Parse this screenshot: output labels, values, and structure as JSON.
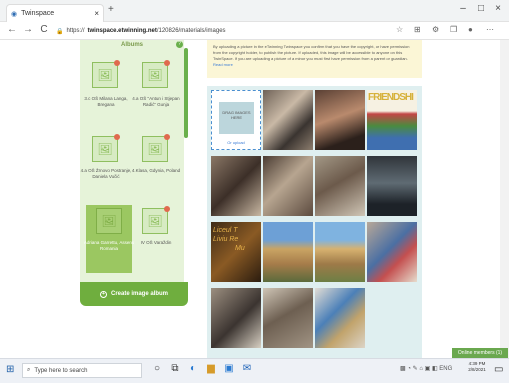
{
  "browser": {
    "tab_title": "Twinspace",
    "tab_close": "×",
    "new_tab": "+",
    "minimize": "–",
    "maximize": "□",
    "close": "×",
    "url_prefix": "https://",
    "url_host": "twinspace.etwinning.net",
    "url_path": "/120826/materials/images",
    "back": "←",
    "forward": "→",
    "reload": "C"
  },
  "albums": {
    "title": "Albums",
    "items": [
      {
        "caption": "3.c OŠ Milana Langa, Bregana"
      },
      {
        "caption": "4.a OŠ \"Antun i Stjepan Radić\" Gunja"
      },
      {
        "caption": "4.a OŠ Žrnovo Postranje, Daniela Vučić"
      },
      {
        "caption": "4.Klasa, Gdynia, Poland"
      },
      {
        "caption": "Adriana Garrettu, Assens Romania"
      },
      {
        "caption": "IV OŠ Varaždin"
      }
    ],
    "create_label": "Create image album"
  },
  "notice": {
    "text": "By uploading a picture in the eTwinning Twinspace you confirm that you have the copyright, or have permission from the copyright holder, to publish the picture. If uploaded, this image will be accessible to anyone on this TwinSpace. If you are uploading a picture of a minor you must first have permission from a parent or guardian.",
    "link": "Read more"
  },
  "upload": {
    "box_text": "DRAG IMAGES HERE",
    "action": "Or upload"
  },
  "gallery": {
    "friendship_text": "FRIENDSHI",
    "school_text_1": "Liceul T",
    "school_text_2": "Liviu Re",
    "school_text_3": "Mu"
  },
  "online_members": "Online members (1)",
  "taskbar": {
    "search_placeholder": "Type here to search",
    "tray": "ENG",
    "time": "4:39 PM",
    "date": "2/8/2021"
  }
}
